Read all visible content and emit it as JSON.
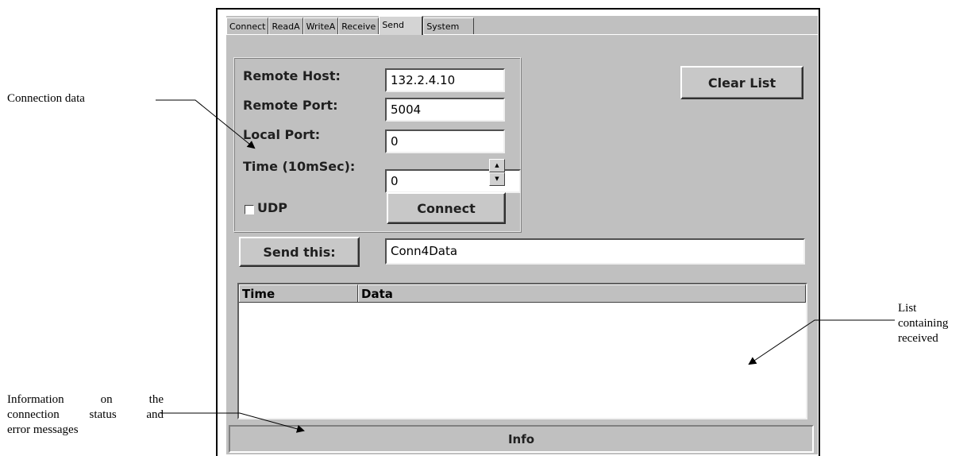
{
  "annotations": {
    "connection_data": "Connection data",
    "list_received": [
      "List",
      "containing",
      "received"
    ],
    "info_status": [
      "Information on the",
      "connection status and",
      "error messages"
    ]
  },
  "tabs": [
    "Connect",
    "ReadA",
    "WriteA",
    "Receive",
    "Send",
    "System"
  ],
  "active_tab": "Send",
  "form": {
    "remote_host_label": "Remote Host:",
    "remote_host_value": "132.2.4.10",
    "remote_port_label": "Remote Port:",
    "remote_port_value": "5004",
    "local_port_label": "Local Port:",
    "local_port_value": "0",
    "time_label": "Time (10mSec):",
    "time_value": "0",
    "udp_label": "UDP",
    "udp_checked": false,
    "connect_button": "Connect"
  },
  "clear_list_button": "Clear List",
  "send": {
    "button": "Send this:",
    "value": "Conn4Data"
  },
  "list": {
    "columns": [
      "Time",
      "Data"
    ],
    "rows": []
  },
  "status_bar": {
    "text": "Info"
  }
}
